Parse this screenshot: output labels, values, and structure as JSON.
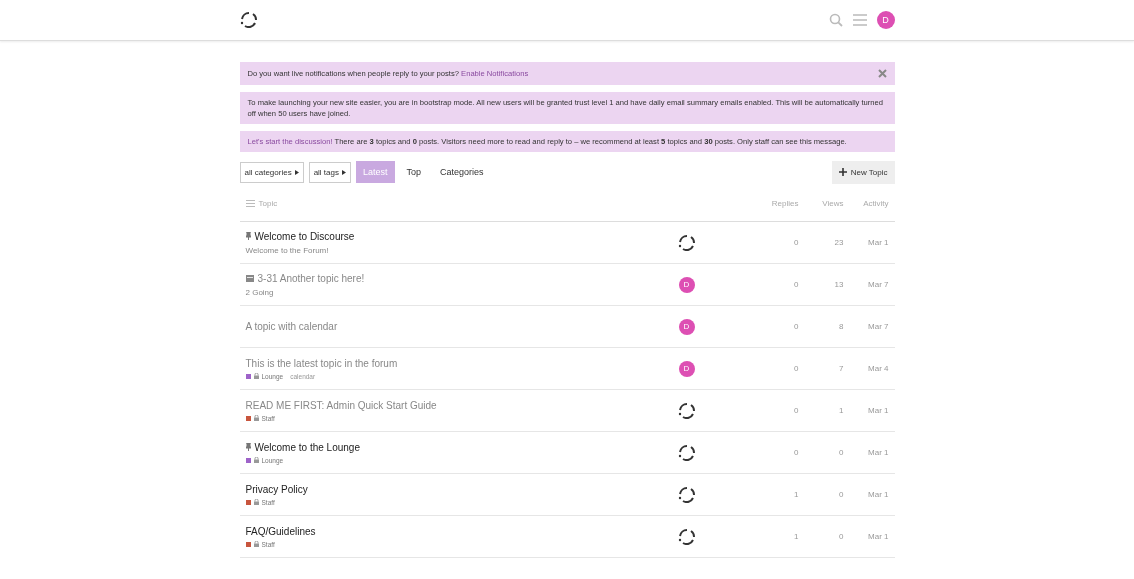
{
  "header": {
    "avatar_letter": "D"
  },
  "banners": [
    {
      "kind": "notify",
      "text": "Do you want live notifications when people reply to your posts?",
      "link": "Enable Notifications",
      "dismissible": true
    },
    {
      "kind": "plain",
      "text": "To make launching your new site easier, you are in bootstrap mode. All new users will be granted trust level 1 and have daily email summary emails enabled. This will be automatically turned off when 50 users have joined."
    },
    {
      "kind": "discussion",
      "link": "Let's start the discussion!",
      "text": " There are **3** topics and **0** posts. Visitors need more to read and reply to – we recommend at least **5** topics and **30** posts. Only staff can see this message."
    }
  ],
  "filters": {
    "category_dropdown": "all categories",
    "tag_dropdown": "all tags",
    "tabs": [
      {
        "label": "Latest",
        "selected": true
      },
      {
        "label": "Top",
        "selected": false
      },
      {
        "label": "Categories",
        "selected": false
      }
    ],
    "new_topic": "New Topic"
  },
  "table": {
    "columns": [
      "Topic",
      "Replies",
      "Views",
      "Activity"
    ],
    "rows": [
      {
        "title": "Welcome to Discourse",
        "pinned": true,
        "calendar": false,
        "visited": false,
        "excerpt": "Welcome to the Forum!",
        "poster": {
          "kind": "logo"
        },
        "replies": "0",
        "views": "23",
        "activity": "Mar 1"
      },
      {
        "title": "3-31 Another topic here!",
        "pinned": false,
        "calendar": true,
        "visited": true,
        "excerpt": "2 Going",
        "poster": {
          "kind": "avatar",
          "letter": "D"
        },
        "replies": "0",
        "views": "13",
        "activity": "Mar 7"
      },
      {
        "title": "A topic with calendar",
        "pinned": false,
        "calendar": false,
        "visited": true,
        "poster": {
          "kind": "avatar",
          "letter": "D"
        },
        "replies": "0",
        "views": "8",
        "activity": "Mar 7"
      },
      {
        "title": "This is the latest topic in the forum",
        "pinned": false,
        "calendar": false,
        "visited": true,
        "category": {
          "name": "Lounge",
          "color": "#9e63c9"
        },
        "tag": "calendar",
        "poster": {
          "kind": "avatar",
          "letter": "D"
        },
        "replies": "0",
        "views": "7",
        "activity": "Mar 4"
      },
      {
        "title": "READ ME FIRST: Admin Quick Start Guide",
        "pinned": false,
        "calendar": false,
        "visited": true,
        "category": {
          "name": "Staff",
          "color": "#c8553d"
        },
        "poster": {
          "kind": "logo"
        },
        "replies": "0",
        "views": "1",
        "activity": "Mar 1"
      },
      {
        "title": "Welcome to the Lounge",
        "pinned": true,
        "calendar": false,
        "visited": false,
        "category": {
          "name": "Lounge",
          "color": "#9e63c9"
        },
        "poster": {
          "kind": "logo"
        },
        "replies": "0",
        "views": "0",
        "activity": "Mar 1"
      },
      {
        "title": "Privacy Policy",
        "pinned": false,
        "calendar": false,
        "visited": false,
        "category": {
          "name": "Staff",
          "color": "#c8553d"
        },
        "poster": {
          "kind": "logo"
        },
        "replies": "1",
        "views": "0",
        "activity": "Mar 1"
      },
      {
        "title": "FAQ/Guidelines",
        "pinned": false,
        "calendar": false,
        "visited": false,
        "category": {
          "name": "Staff",
          "color": "#c8553d"
        },
        "poster": {
          "kind": "logo"
        },
        "replies": "1",
        "views": "0",
        "activity": "Mar 1"
      }
    ]
  }
}
